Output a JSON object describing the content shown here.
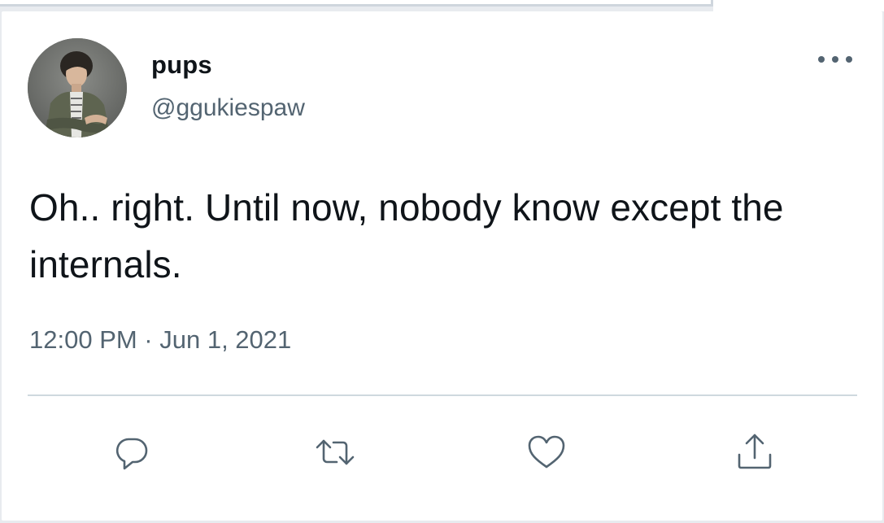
{
  "tweet": {
    "author": {
      "display_name": "pups",
      "handle": "@ggukiespaw"
    },
    "text": "Oh.. right. Until now, nobody know except the internals.",
    "timestamp": "12:00 PM · Jun 1, 2021",
    "actions": {
      "reply_icon": "speech-bubble",
      "retweet_icon": "retweet-arrows",
      "like_icon": "heart",
      "share_icon": "share-upload"
    }
  },
  "colors": {
    "text_primary": "#0f1419",
    "text_secondary": "#536471",
    "divider": "#cfd9de",
    "background": "#ffffff"
  }
}
